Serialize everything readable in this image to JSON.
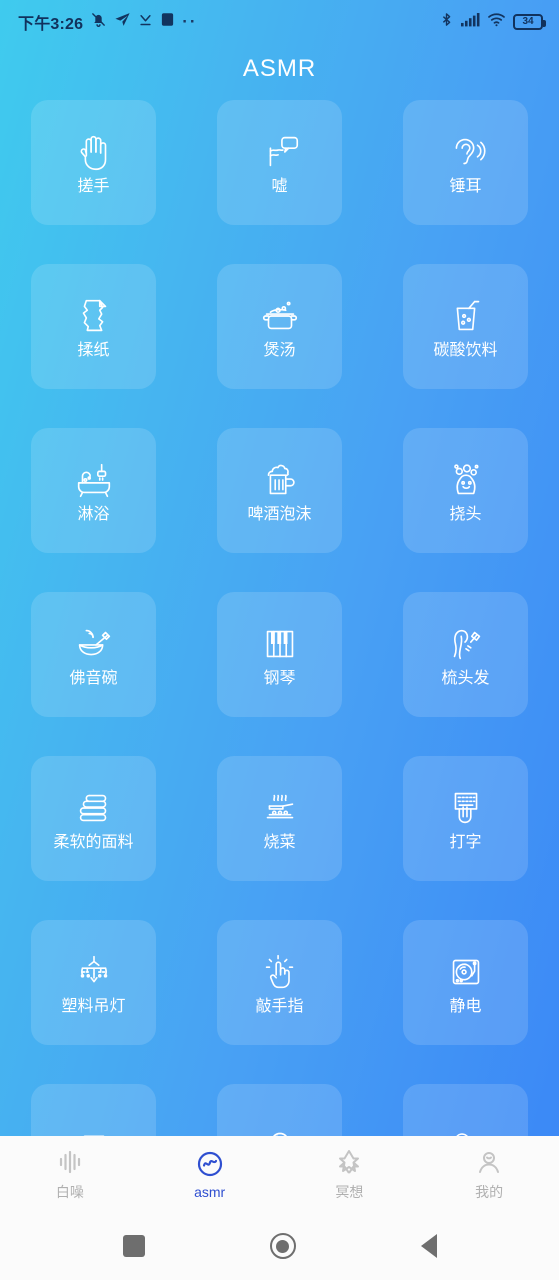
{
  "statusbar": {
    "time": "下午3:26",
    "battery_level": "34",
    "left_icons": [
      "bell-muted-icon",
      "paper-plane-icon",
      "download-icon",
      "app-square-icon",
      "more-dots-icon"
    ],
    "right_icons": [
      "bluetooth-icon",
      "signal-bars-icon",
      "wifi-icon",
      "battery-icon"
    ],
    "overflow_dots": "··"
  },
  "header": {
    "title": "ASMR"
  },
  "colors": {
    "gradient_start": "#3fcbee",
    "gradient_end": "#3a86f6",
    "tile_overlay": "rgba(255,255,255,0.14)",
    "tab_active": "#2f4fd0",
    "tab_inactive": "#b0b0b0",
    "navbar_bg": "#fbfbfb"
  },
  "grid": {
    "columns": 3,
    "items": [
      {
        "label": "搓手",
        "icon": "hand-icon"
      },
      {
        "label": "嘘",
        "icon": "shush-speech-bubble-icon"
      },
      {
        "label": "锤耳",
        "icon": "ear-icon"
      },
      {
        "label": "揉纸",
        "icon": "crumpled-paper-icon"
      },
      {
        "label": "煲汤",
        "icon": "soup-pot-icon"
      },
      {
        "label": "碳酸饮料",
        "icon": "soda-glass-icon"
      },
      {
        "label": "淋浴",
        "icon": "bathtub-shower-icon"
      },
      {
        "label": "啤酒泡沫",
        "icon": "beer-mug-icon"
      },
      {
        "label": "挠头",
        "icon": "shampoo-head-icon"
      },
      {
        "label": "佛音碗",
        "icon": "singing-bowl-icon"
      },
      {
        "label": "钢琴",
        "icon": "piano-keys-icon"
      },
      {
        "label": "梳头发",
        "icon": "hair-brush-icon"
      },
      {
        "label": "柔软的面料",
        "icon": "folded-towels-icon"
      },
      {
        "label": "烧菜",
        "icon": "stove-pan-icon"
      },
      {
        "label": "打字",
        "icon": "typing-keyboard-icon"
      },
      {
        "label": "塑料吊灯",
        "icon": "chandelier-icon"
      },
      {
        "label": "敲手指",
        "icon": "tapping-finger-icon"
      },
      {
        "label": "静电",
        "icon": "turntable-icon"
      },
      {
        "label": "",
        "icon": "water-glass-icon"
      },
      {
        "label": "",
        "icon": "face-icon"
      },
      {
        "label": "",
        "icon": "clouds-icon"
      }
    ]
  },
  "tabbar": {
    "items": [
      {
        "label": "白噪",
        "icon": "waveform-icon",
        "active": false
      },
      {
        "label": "asmr",
        "icon": "asmr-wave-circle-icon",
        "active": true
      },
      {
        "label": "冥想",
        "icon": "lotus-star-icon",
        "active": false
      },
      {
        "label": "我的",
        "icon": "person-icon",
        "active": false
      }
    ]
  },
  "navbar": {
    "items": [
      {
        "name": "recents-button",
        "icon": "square-icon"
      },
      {
        "name": "home-button",
        "icon": "circle-icon"
      },
      {
        "name": "back-button",
        "icon": "triangle-left-icon"
      }
    ]
  }
}
